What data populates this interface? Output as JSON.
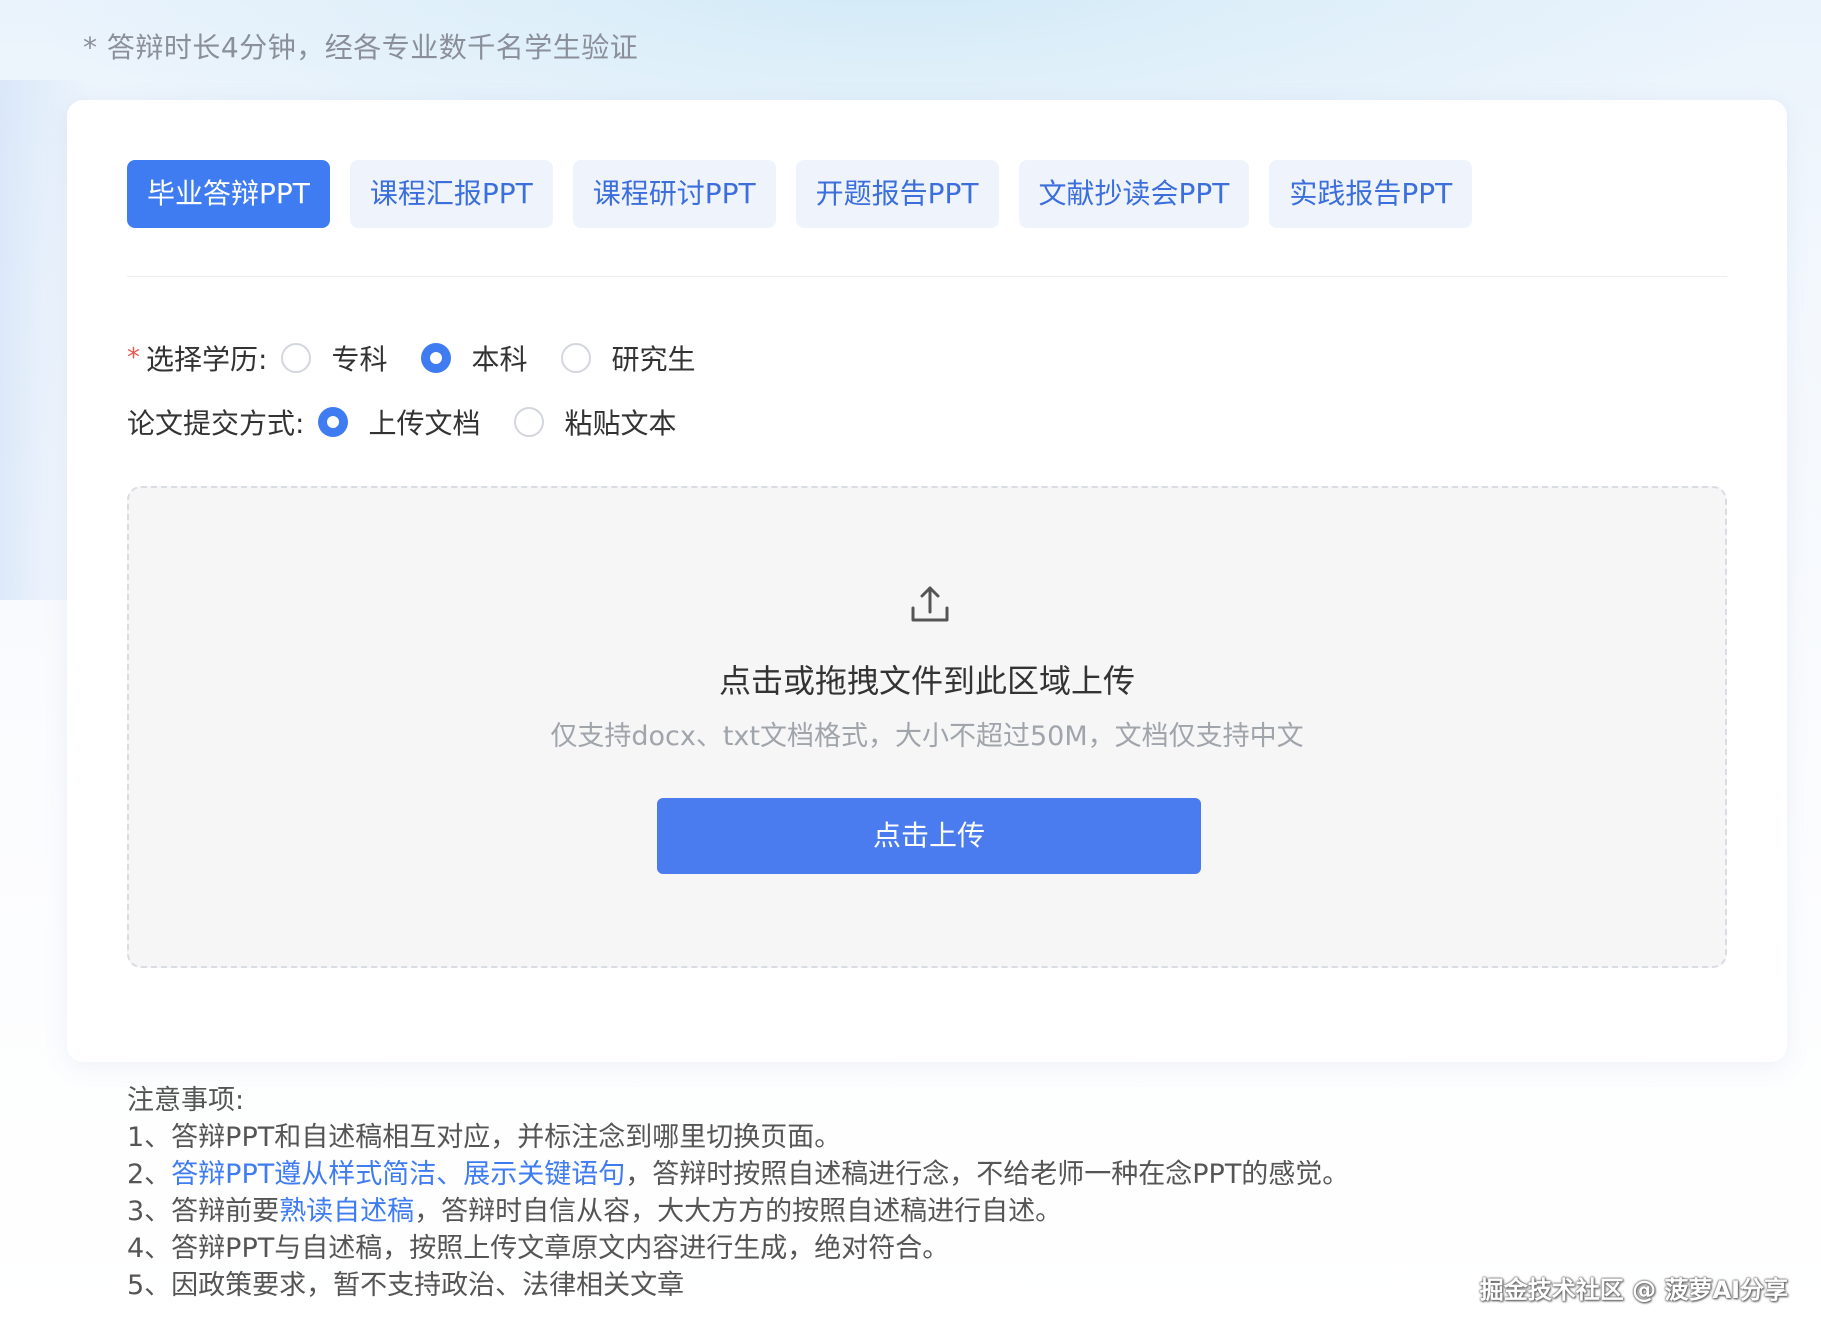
{
  "subtitle": "* 答辩时长4分钟，经各专业数千名学生验证",
  "tabs": [
    {
      "label": "毕业答辩PPT",
      "active": true
    },
    {
      "label": "课程汇报PPT",
      "active": false
    },
    {
      "label": "课程研讨PPT",
      "active": false
    },
    {
      "label": "开题报告PPT",
      "active": false
    },
    {
      "label": "文献抄读会PPT",
      "active": false
    },
    {
      "label": "实践报告PPT",
      "active": false
    }
  ],
  "education": {
    "required_mark": "*",
    "label": "选择学历:",
    "options": [
      "专科",
      "本科",
      "研究生"
    ],
    "selected": "本科"
  },
  "submit_method": {
    "label": "论文提交方式:",
    "options": [
      "上传文档",
      "粘贴文本"
    ],
    "selected": "上传文档"
  },
  "dropzone": {
    "icon": "upload-icon",
    "title": "点击或拖拽文件到此区域上传",
    "hint": "仅支持docx、txt文档格式，大小不超过50M，文档仅支持中文",
    "button_label": "点击上传"
  },
  "notes": {
    "heading": "注意事项:",
    "item1": "1、答辩PPT和自述稿相互对应，并标注念到哪里切换页面。",
    "item2_prefix": "2、",
    "item2_highlight": "答辩PPT遵从样式简洁、展示关键语句",
    "item2_suffix": "，答辩时按照自述稿进行念，不给老师一种在念PPT的感觉。",
    "item3_prefix": "3、答辩前要",
    "item3_highlight": "熟读自述稿",
    "item3_suffix": "，答辩时自信从容，大大方方的按照自述稿进行自述。",
    "item4": "4、答辩PPT与自述稿，按照上传文章原文内容进行生成，绝对符合。",
    "item5": "5、因政策要求，暂不支持政治、法律相关文章"
  },
  "watermark": "掘金技术社区 @ 菠萝AI分享",
  "colors": {
    "primary": "#3f7cf2",
    "tab_bg": "#eef3fc",
    "required": "#e85a4f",
    "dropzone_bg": "#f6f6f7"
  }
}
